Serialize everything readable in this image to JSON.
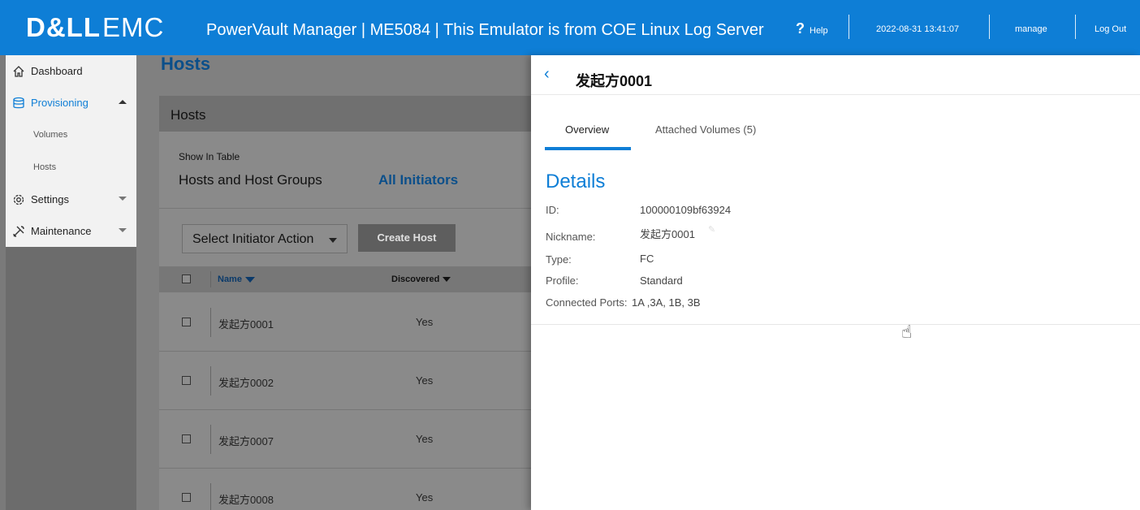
{
  "topbar": {
    "logo_dell": "D&LL",
    "logo_emc": "EMC",
    "title": "PowerVault Manager | ME5084 | This Emulator is from COE Linux Log Server",
    "help_glyph": "?",
    "help_label": "Help",
    "datetime": "2022-08-31 13:41:07",
    "user": "manage",
    "logout": "Log Out",
    "color": "#0e7ed6"
  },
  "sidebar": {
    "items": [
      {
        "label": "Dashboard",
        "icon": "home-icon"
      },
      {
        "label": "Provisioning",
        "icon": "database-icon",
        "active": true
      },
      {
        "label": "Volumes"
      },
      {
        "label": "Hosts"
      },
      {
        "label": "Settings",
        "icon": "gear-icon"
      },
      {
        "label": "Maintenance",
        "icon": "tools-icon"
      }
    ]
  },
  "main": {
    "page_title": "Hosts",
    "panel_title": "Hosts",
    "show_in_table": "Show In Table",
    "tab_hosts": "Hosts and Host Groups",
    "tab_initiators": "All Initiators",
    "select_action": "Select Initiator Action",
    "create_host": "Create Host",
    "columns": {
      "name": "Name",
      "discovered": "Discovered"
    },
    "rows": [
      {
        "name": "发起方0001",
        "discovered": "Yes"
      },
      {
        "name": "发起方0002",
        "discovered": "Yes"
      },
      {
        "name": "发起方0007",
        "discovered": "Yes"
      },
      {
        "name": "发起方0008",
        "discovered": "Yes"
      }
    ]
  },
  "detail": {
    "back_glyph": "‹",
    "title": "发起方0001",
    "tabs": {
      "overview": "Overview",
      "attached": "Attached Volumes (5)"
    },
    "heading": "Details",
    "fields": {
      "id_label": "ID:",
      "id_value": "100000109bf63924",
      "nickname_label": "Nickname:",
      "nickname_value": "发起方0001",
      "type_label": "Type:",
      "type_value": "FC",
      "profile_label": "Profile:",
      "profile_value": "Standard",
      "ports_label": "Connected Ports:",
      "ports_value": "1A ,3A, 1B, 3B"
    }
  }
}
